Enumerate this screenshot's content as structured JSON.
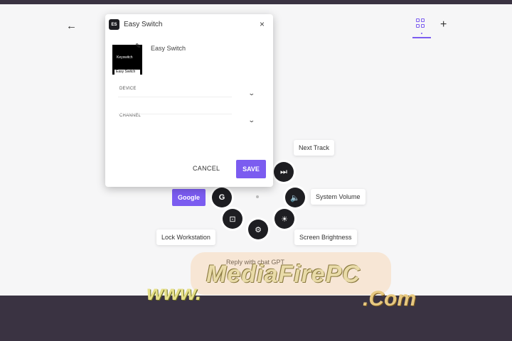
{
  "toolbar": {
    "back_icon": "arrow-left-icon",
    "back_glyph": "←",
    "grid_icon": "grid-icon",
    "plus_icon": "plus-icon",
    "plus_glyph": "+",
    "accent_color": "#7b5cf0"
  },
  "dialog": {
    "app_badge": "ES",
    "title": "Easy Switch",
    "close_glyph": "×",
    "thumbnail": {
      "top_text": "Keyswitch",
      "bottom_text": "Easy Switch"
    },
    "edit_icon": "pencil-icon",
    "edit_glyph": "✎",
    "name_value": "Easy Switch",
    "fields": [
      {
        "label": "DEVICE",
        "chevron": "⌄"
      },
      {
        "label": "CHANNEL",
        "chevron": "⌄"
      }
    ],
    "cancel_label": "CANCEL",
    "save_label": "SAVE"
  },
  "radial_menu": {
    "google_label": "Google",
    "google_icon_glyph": "G",
    "actions": [
      {
        "label": "Next Track",
        "icon": "next-track-icon",
        "glyph": "⏭"
      },
      {
        "label": "System Volume",
        "icon": "volume-icon",
        "glyph": "🔈"
      },
      {
        "label": "Screen Brightness",
        "icon": "brightness-icon",
        "glyph": "☀"
      },
      {
        "label": "Reply with chat GPT",
        "icon": "chatgpt-icon",
        "glyph": "⚙"
      },
      {
        "label": "Lock Workstation",
        "icon": "lock-workstation-icon",
        "glyph": "⊡"
      }
    ]
  },
  "watermark": {
    "main": "MediaFirePC",
    "www": "www.",
    "com": ".Com"
  }
}
